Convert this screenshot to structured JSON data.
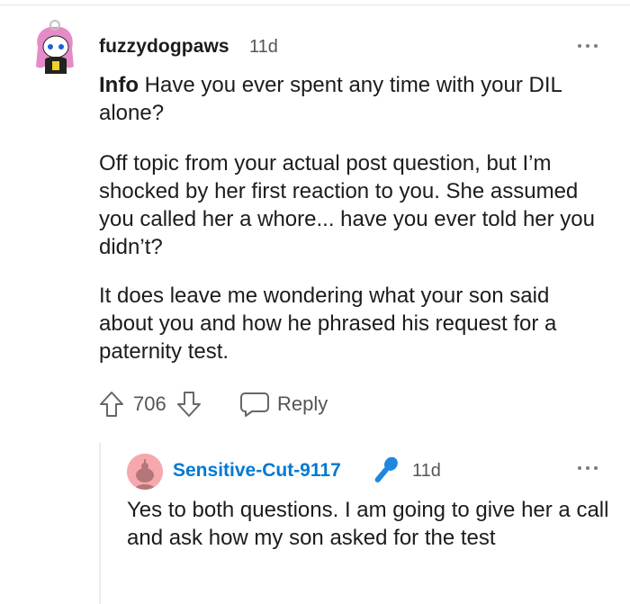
{
  "comment": {
    "username": "fuzzydogpaws",
    "age": "11d",
    "lead_label": "Info",
    "p1_rest": "Have you ever spent any time with your DIL alone?",
    "p2": "Off topic from your actual post question, but I’m shocked by her first reaction to you. She assumed you called her a whore... have you ever told her you didn’t?",
    "p3": "It does leave me wondering what your son said about you and how he phrased his request for a paternity test.",
    "score": "706",
    "reply_label": "Reply",
    "icons": {
      "upvote": "upvote-arrow-icon",
      "downvote": "downvote-arrow-icon",
      "reply": "speech-bubble-icon",
      "more": "more-options-icon",
      "avatar": "snoo-avatar"
    }
  },
  "reply": {
    "username": "Sensitive-Cut-9117",
    "flair_icon": "microphone-icon",
    "age": "11d",
    "text": "Yes to both questions. I am going to give her a call and ask how my son asked for the test",
    "username_color": "#0079d3"
  },
  "colors": {
    "text": "#1c1c1c",
    "meta": "#555555",
    "link_blue": "#0079d3",
    "avatar_pink": "#f5a9ad"
  }
}
